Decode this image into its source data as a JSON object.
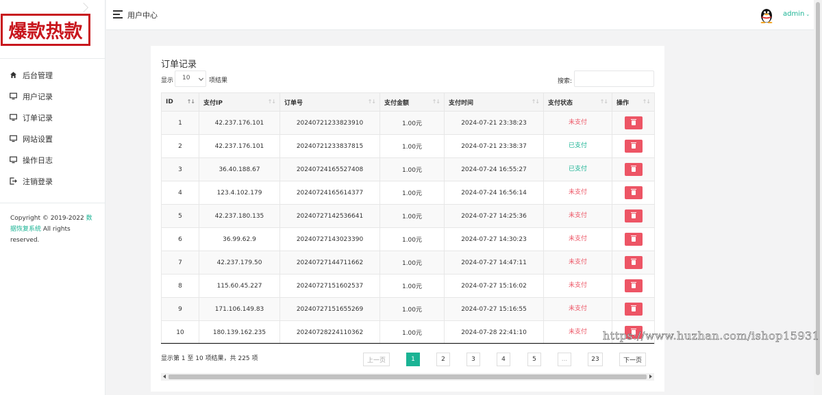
{
  "brand": {
    "logo_text": "爆款热款",
    "logo_color": "#c8161d"
  },
  "sidebar": {
    "items": [
      {
        "label": "后台管理",
        "icon": "home-icon"
      },
      {
        "label": "用户记录",
        "icon": "monitor-icon"
      },
      {
        "label": "订单记录",
        "icon": "monitor-icon"
      },
      {
        "label": "网站设置",
        "icon": "monitor-icon"
      },
      {
        "label": "操作日志",
        "icon": "monitor-icon"
      },
      {
        "label": "注销登录",
        "icon": "logout-icon"
      }
    ],
    "copyright_prefix": "Copyright © 2019-2022 ",
    "copyright_link": "数据恢复系统",
    "copyright_suffix": " All rights reserved."
  },
  "header": {
    "title": "用户中心",
    "user": "admin",
    "avatar_icon": "qq-penguin-icon"
  },
  "card": {
    "title": "订单记录",
    "length_prefix": "显示",
    "length_value": "10",
    "length_suffix": "项结果",
    "search_label": "搜索:",
    "search_value": ""
  },
  "table": {
    "columns": [
      "ID",
      "支付IP",
      "订单号",
      "支付金额",
      "支付时间",
      "支付状态",
      "操作"
    ],
    "rows": [
      {
        "id": "1",
        "ip": "42.237.176.101",
        "order": "20240721233823910",
        "amount": "1.00元",
        "time": "2024-07-21 23:38:23",
        "status": "未支付"
      },
      {
        "id": "2",
        "ip": "42.237.176.101",
        "order": "20240721233837815",
        "amount": "1.00元",
        "time": "2024-07-21 23:38:37",
        "status": "已支付"
      },
      {
        "id": "3",
        "ip": "36.40.188.67",
        "order": "20240724165527408",
        "amount": "1.00元",
        "time": "2024-07-24 16:55:27",
        "status": "已支付"
      },
      {
        "id": "4",
        "ip": "123.4.102.179",
        "order": "20240724165614377",
        "amount": "1.00元",
        "time": "2024-07-24 16:56:14",
        "status": "未支付"
      },
      {
        "id": "5",
        "ip": "42.237.180.135",
        "order": "20240727142536641",
        "amount": "1.00元",
        "time": "2024-07-27 14:25:36",
        "status": "未支付"
      },
      {
        "id": "6",
        "ip": "36.99.62.9",
        "order": "20240727143023390",
        "amount": "1.00元",
        "time": "2024-07-27 14:30:23",
        "status": "未支付"
      },
      {
        "id": "7",
        "ip": "42.237.179.50",
        "order": "20240727144711662",
        "amount": "1.00元",
        "time": "2024-07-27 14:47:11",
        "status": "未支付"
      },
      {
        "id": "8",
        "ip": "115.60.45.227",
        "order": "20240727151602537",
        "amount": "1.00元",
        "time": "2024-07-27 15:16:02",
        "status": "未支付"
      },
      {
        "id": "9",
        "ip": "171.106.149.83",
        "order": "20240727151655269",
        "amount": "1.00元",
        "time": "2024-07-27 15:16:55",
        "status": "未支付"
      },
      {
        "id": "10",
        "ip": "180.139.162.235",
        "order": "20240728224110362",
        "amount": "1.00元",
        "time": "2024-07-28 22:41:10",
        "status": "未支付"
      }
    ],
    "status_colors": {
      "未支付": "#ed5565",
      "已支付": "#1ab394"
    },
    "delete_icon": "trash-icon"
  },
  "footer": {
    "info": "显示第 1 至 10 项结果，共 225 项",
    "pagination": [
      "上一页",
      "1",
      "2",
      "3",
      "4",
      "5",
      "...",
      "23",
      "下一页"
    ],
    "active_page": "1"
  },
  "watermark": "https://www.huzhan.com/ishop15931",
  "accent_color": "#1ab394"
}
